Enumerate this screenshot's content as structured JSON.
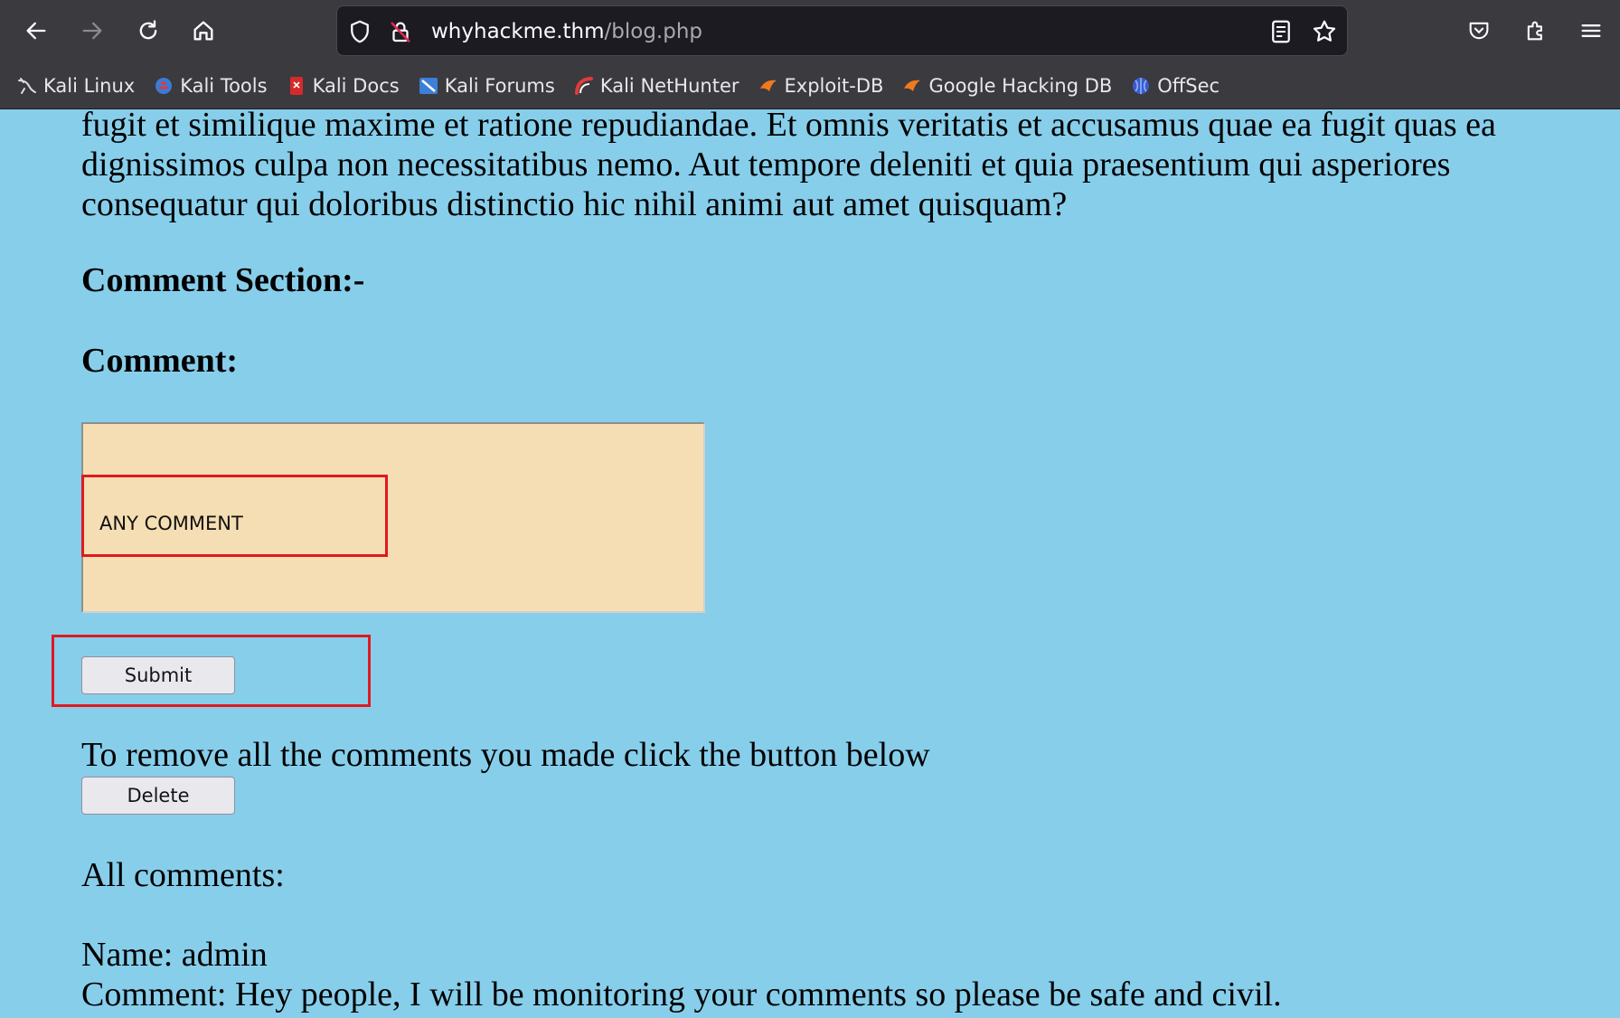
{
  "browser": {
    "url_host": "whyhackme.thm",
    "url_path": "/blog.php",
    "bookmarks": [
      {
        "label": "Kali Linux",
        "icon": "kali-dragon-icon"
      },
      {
        "label": "Kali Tools",
        "icon": "kali-tools-icon"
      },
      {
        "label": "Kali Docs",
        "icon": "kali-docs-icon"
      },
      {
        "label": "Kali Forums",
        "icon": "kali-forums-icon"
      },
      {
        "label": "Kali NetHunter",
        "icon": "nethunter-icon"
      },
      {
        "label": "Exploit-DB",
        "icon": "exploitdb-icon"
      },
      {
        "label": "Google Hacking DB",
        "icon": "ghdb-icon"
      },
      {
        "label": "OffSec",
        "icon": "offsec-icon"
      }
    ]
  },
  "page": {
    "intro_paragraph": "fugit et similique maxime et ratione repudiandae. Et omnis veritatis et accusamus quae ea fugit quas ea dignissimos culpa non necessitatibus nemo. Aut tempore deleniti et quia praesentium qui asperiores consequatur qui doloribus distinctio hic nihil animi aut amet quisquam?",
    "section_heading": "Comment Section:-",
    "comment_label": "Comment:",
    "comment_value": "ANY COMMENT",
    "submit_label": "Submit",
    "remove_text": "To remove all the comments you made click the button below",
    "delete_label": "Delete",
    "all_comments_label": "All comments:",
    "comments": [
      {
        "name_line": "Name: admin",
        "comment_line": "Comment: Hey people, I will be monitoring your comments so please be safe and civil."
      }
    ]
  },
  "colors": {
    "page_background": "#87ceeb",
    "textarea_background": "#f5deb3",
    "highlight_border": "#e0191f",
    "browser_chrome": "#3b3a3f"
  }
}
